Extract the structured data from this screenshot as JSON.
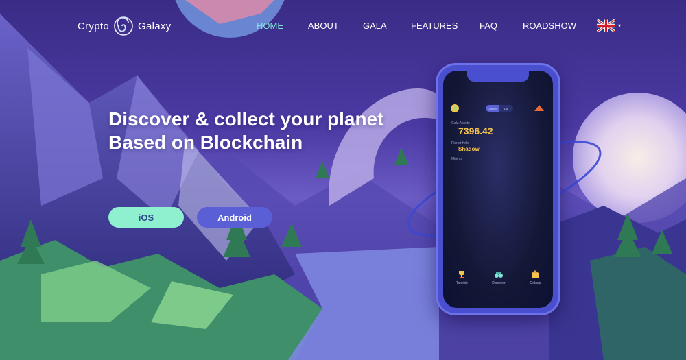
{
  "brand": {
    "name_left": "Crypto",
    "name_right": "Galaxy",
    "logo_icon": "spiral-galaxy-icon"
  },
  "nav": {
    "items": [
      {
        "label": "HOME",
        "active": true
      },
      {
        "label": "ABOUT",
        "active": false
      },
      {
        "label": "GALA",
        "active": false
      },
      {
        "label": "FEATURES",
        "active": false
      },
      {
        "label": "FAQ",
        "active": false
      },
      {
        "label": "ROADSHOW",
        "active": false
      }
    ],
    "language_icon": "uk-flag-icon",
    "language_caret": "▾"
  },
  "hero": {
    "title_line1": "Discover & collect your planet",
    "title_line2": "Based on Blockchain",
    "ios_label": "iOS",
    "android_label": "Android"
  },
  "phone": {
    "toggle_left": "Claimed",
    "toggle_right": "Dig",
    "assets_label": "Gala Assets",
    "assets_value": "7396.42",
    "planet_label": "Planet Hold",
    "planet_value": "Shadow",
    "mining_label": "Mining",
    "bottom_nav": [
      {
        "label": "Ranklist",
        "icon": "trophy-icon"
      },
      {
        "label": "Discover",
        "icon": "binoculars-icon"
      },
      {
        "label": "Galaxp",
        "icon": "treasure-icon"
      }
    ]
  },
  "colors": {
    "accent_mint": "#8ff0cf",
    "accent_indigo": "#5b5fd6",
    "nav_active": "#7fe3d6",
    "gold": "#f3c34c"
  }
}
